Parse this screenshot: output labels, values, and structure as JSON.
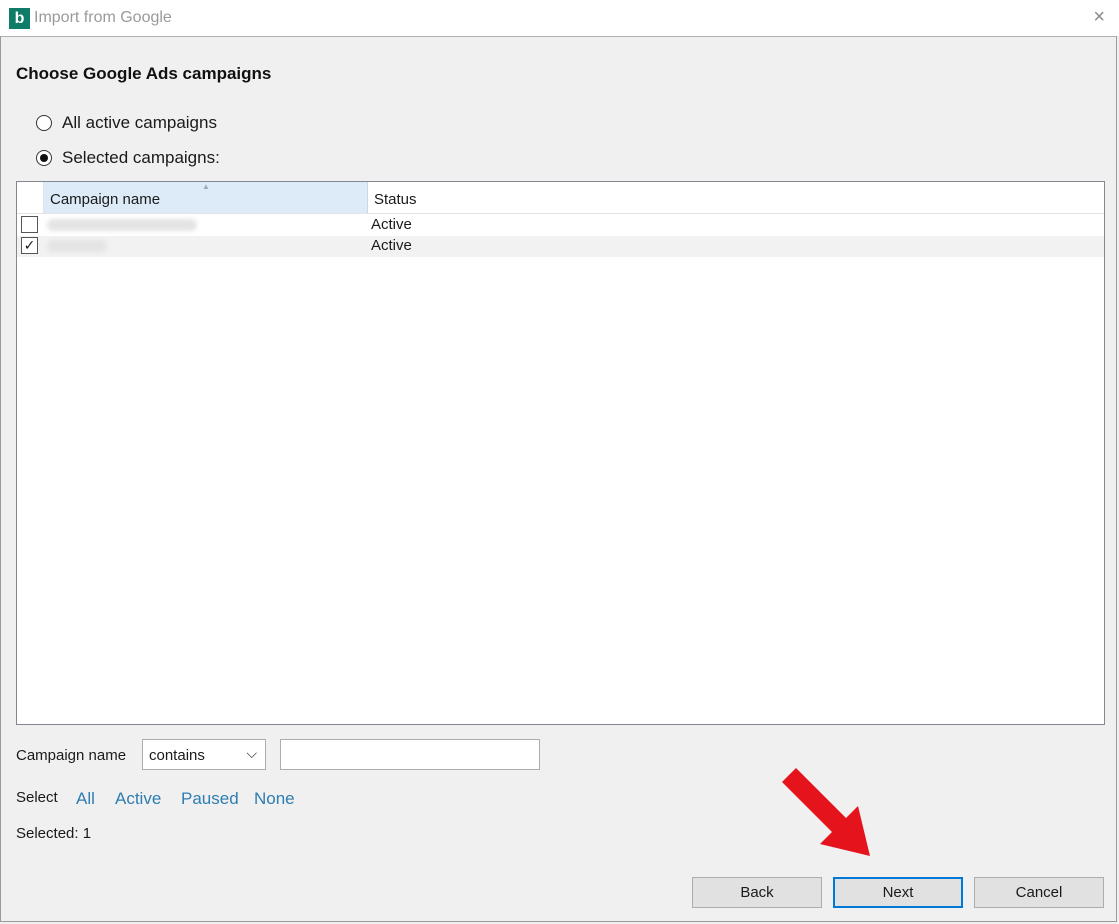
{
  "window": {
    "title": "Import from Google",
    "logo_letter": "b"
  },
  "heading": "Choose Google Ads campaigns",
  "options": [
    {
      "label": "All active campaigns",
      "checked": false
    },
    {
      "label": "Selected campaigns:",
      "checked": true
    }
  ],
  "table": {
    "columns": [
      "Campaign name",
      "Status"
    ],
    "rows": [
      {
        "checked": false,
        "status": "Active"
      },
      {
        "checked": true,
        "status": "Active"
      }
    ]
  },
  "filter": {
    "label": "Campaign name",
    "operator": "contains",
    "value": ""
  },
  "select": {
    "label": "Select",
    "links": [
      "All",
      "Active",
      "Paused",
      "None"
    ]
  },
  "selected_text": "Selected: 1",
  "buttons": {
    "back": "Back",
    "next": "Next",
    "cancel": "Cancel"
  },
  "icons": {
    "close": "×",
    "chevron": "⌵",
    "check": "✓"
  },
  "colors": {
    "accent": "#0078d7",
    "link": "#2f7db1",
    "logo": "#0f7c6a",
    "annotation_arrow": "#e5141c"
  }
}
